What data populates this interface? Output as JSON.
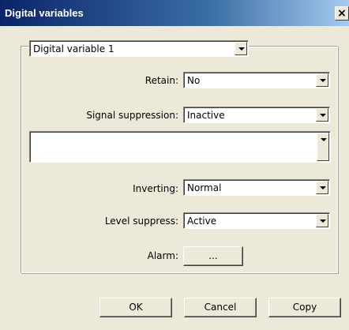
{
  "window": {
    "title": "Digital variables",
    "close_glyph": "×"
  },
  "variable_select": {
    "value": "Digital variable 1"
  },
  "fields": {
    "retain": {
      "label": "Retain:",
      "value": "No"
    },
    "signal_suppression": {
      "label": "Signal suppression:",
      "value": "Inactive"
    },
    "extra": {
      "value": ""
    },
    "inverting": {
      "label": "Inverting:",
      "value": "Normal"
    },
    "level_suppress": {
      "label": "Level suppress:",
      "value": "Active"
    },
    "alarm": {
      "label": "Alarm:",
      "button_label": "..."
    }
  },
  "buttons": {
    "ok": "OK",
    "cancel": "Cancel",
    "copy": "Copy"
  },
  "icons": {
    "dropdown": "chevron-down-icon",
    "close": "close-icon"
  }
}
